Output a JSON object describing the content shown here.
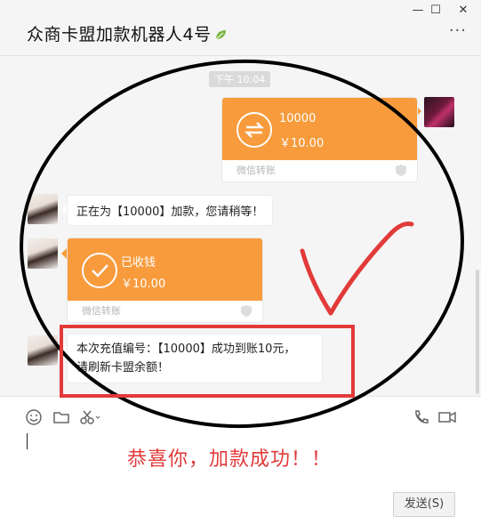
{
  "window": {
    "title": "众商卡盟加款机器人4号",
    "controls": {
      "minimize": "—",
      "maximize": "☐",
      "close": "✕"
    },
    "more": "···"
  },
  "chat": {
    "timestamp": "下午 10:04",
    "sent_transfer": {
      "amount": "10000",
      "price": "￥10.00",
      "footer": "微信转账"
    },
    "bot_message_1": "正在为【10000】加款，您请稍等！",
    "received_transfer": {
      "status": "已收钱",
      "price": "￥10.00",
      "footer": "微信转账"
    },
    "bot_message_2_line1": "本次充值编号：【10000】成功到账10元，",
    "bot_message_2_line2": "请刷新卡盟余额！"
  },
  "composer": {
    "overlay_text": "恭喜你，加款成功！！",
    "send_label": "发送(S)"
  },
  "colors": {
    "transfer_orange": "#f79b3c",
    "annotation_red": "#e23a3a",
    "annotation_black": "#000000"
  }
}
